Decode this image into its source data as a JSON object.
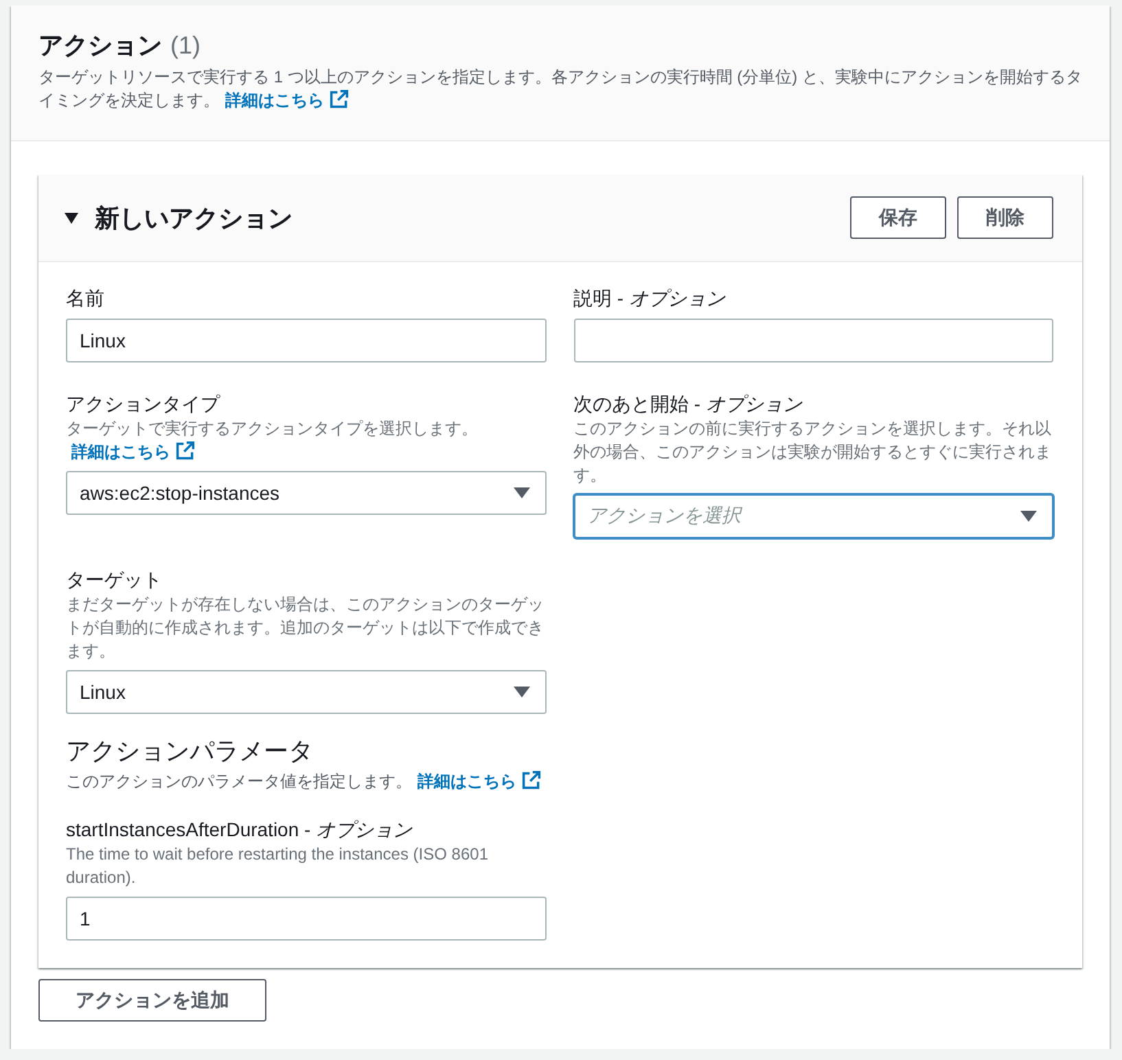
{
  "section": {
    "title": "アクション",
    "count": "(1)",
    "description": "ターゲットリソースで実行する 1 つ以上のアクションを指定します。各アクションの実行時間 (分単位) と、実験中にアクションを開始するタイミングを決定します。",
    "link": "詳細はこちら"
  },
  "action_card": {
    "title": "新しいアクション",
    "expanded": true,
    "buttons": [
      "保存",
      "削除"
    ],
    "fields": [
      {
        "kind": "input",
        "label": "名前",
        "value": "Linux",
        "focused": false
      },
      {
        "kind": "input",
        "label": "説明 - *オプション*",
        "focused": false
      },
      {
        "kind": "select",
        "label": "アクションタイプ",
        "description": "ターゲットで実行するアクションタイプを選択します。",
        "link": "詳細はこちら",
        "value": "aws:ec2:stop-instances",
        "focused": false
      },
      {
        "kind": "select",
        "label": "次のあと開始 - *オプション*",
        "description": "このアクションの前に実行するアクションを選択します。それ以外の場合、このアクションは実験が開始するとすぐに実行されます。",
        "placeholder": "アクションを選択",
        "focused": true
      },
      {
        "kind": "select",
        "label": "ターゲット",
        "description": "まだターゲットが存在しない場合は、このアクションのターゲットが自動的に作成されます。追加のターゲットは以下で作成できます。",
        "value": "Linux",
        "focused": false
      }
    ],
    "parameters": {
      "title": "アクションパラメータ",
      "description": "このアクションのパラメータ値を指定します。",
      "link": "詳細はこちら",
      "fields": [
        {
          "kind": "input",
          "label": "startInstancesAfterDuration - *オプション*",
          "description": "The time to wait before restarting the instances (ISO 8601 duration).",
          "value": "1",
          "focused": false
        }
      ]
    }
  },
  "add_button": "アクションを追加"
}
